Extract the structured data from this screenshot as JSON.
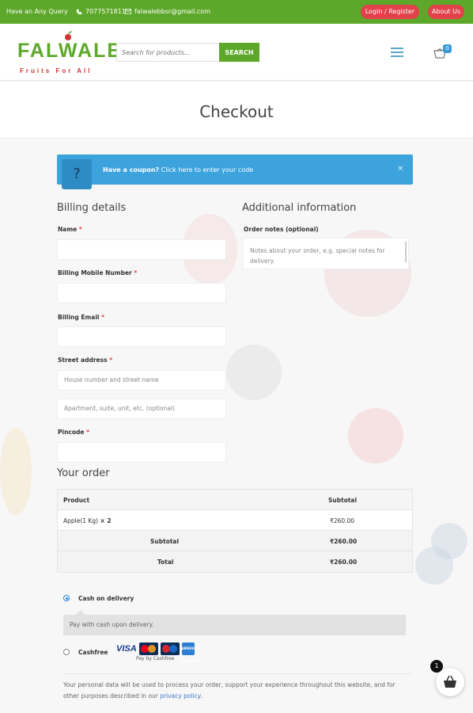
{
  "topbar": {
    "query_label": "Have an Any Query",
    "phone": "7077571811",
    "email": "falwalebbsr@gmail.com",
    "login_label": "Login / Register",
    "about_label": "About Us"
  },
  "header": {
    "logo_text": "FALWALE",
    "logo_tagline": "Fruits For All",
    "search_placeholder": "Search for products...",
    "search_button": "SEARCH",
    "cart_count": "0"
  },
  "page": {
    "title": "Checkout"
  },
  "coupon": {
    "icon": "?",
    "prompt": "Have a coupon?",
    "link": "Click here to enter your code",
    "close": "×"
  },
  "billing": {
    "heading": "Billing details",
    "fields": [
      {
        "label": "Name",
        "required": "*",
        "placeholder": ""
      },
      {
        "label": "Billing Mobile Number",
        "required": "*",
        "placeholder": ""
      },
      {
        "label": "Billing Email",
        "required": "*",
        "placeholder": ""
      },
      {
        "label": "Street address",
        "required": "*",
        "placeholder": "House number and street name"
      },
      {
        "label": "",
        "required": "",
        "placeholder": "Apartment, suite, unit, etc. (optional)"
      },
      {
        "label": "Pincode",
        "required": "*",
        "placeholder": ""
      }
    ]
  },
  "additional": {
    "heading": "Additional information",
    "notes_label": "Order notes (optional)",
    "notes_placeholder": "Notes about your order, e.g. special notes for delivery."
  },
  "order": {
    "heading": "Your order",
    "col_product": "Product",
    "col_subtotal": "Subtotal",
    "item_name": "Apple(1 Kg)",
    "item_qty": "× 2",
    "item_subtotal": "₹260.00",
    "subtotal_label": "Subtotal",
    "subtotal_value": "₹260.00",
    "total_label": "Total",
    "total_value": "₹260.00"
  },
  "payment": {
    "cod_label": "Cash on delivery",
    "cod_desc": "Pay with cash upon delivery.",
    "cashfree_label": "Cashfree",
    "visa": "VISA",
    "amex": "AMERICAN EXPRESS",
    "pay_by": "Pay by Cashfree"
  },
  "privacy": {
    "text": "Your personal data will be used to process your order, support your experience throughout this website, and for other purposes described in our ",
    "link": "privacy policy."
  },
  "floating_cart": {
    "count": "1"
  },
  "colors": {
    "brand_green": "#5da82a",
    "accent_red": "#e2404a",
    "coupon_blue": "#3da3dc"
  }
}
